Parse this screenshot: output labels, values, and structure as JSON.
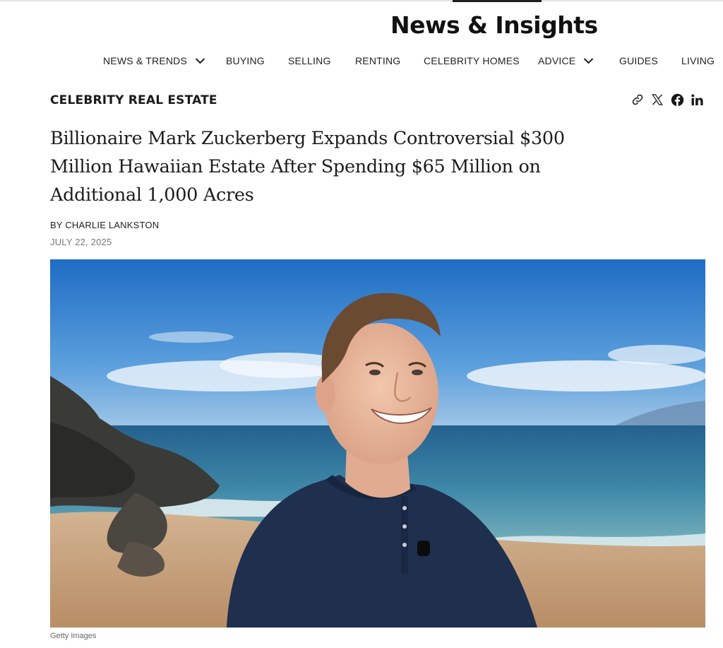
{
  "header": {
    "brand": "News & Insights"
  },
  "nav": {
    "items": [
      {
        "label": "NEWS & TRENDS",
        "has_dropdown": true
      },
      {
        "label": "BUYING",
        "has_dropdown": false
      },
      {
        "label": "SELLING",
        "has_dropdown": false
      },
      {
        "label": "RENTING",
        "has_dropdown": false
      },
      {
        "label": "CELEBRITY HOMES",
        "has_dropdown": false
      },
      {
        "label": "ADVICE",
        "has_dropdown": true
      },
      {
        "label": "GUIDES",
        "has_dropdown": false
      },
      {
        "label": "LIVING",
        "has_dropdown": false
      }
    ]
  },
  "article": {
    "category": "CELEBRITY REAL ESTATE",
    "headline": "Billionaire Mark Zuckerberg Expands Controversial $300 Million Hawaiian Estate After Spending $65 Million on Additional 1,000 Acres",
    "byline": "BY CHARLIE LANKSTON",
    "date": "JULY 22, 2025",
    "image_caption": "Getty Images"
  },
  "share": {
    "icons": [
      "link-icon",
      "x-icon",
      "facebook-icon",
      "linkedin-icon"
    ]
  },
  "colors": {
    "text": "#1a1a1a",
    "muted": "#777777",
    "sky": "#2e7fd0",
    "ocean": "#2c6f99",
    "sand": "#c9a27e",
    "shirt": "#1f2f4e"
  }
}
